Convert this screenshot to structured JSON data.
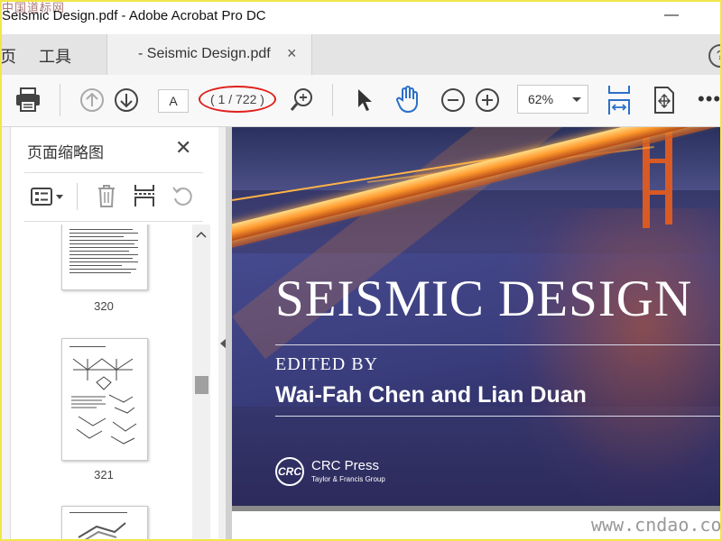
{
  "watermark": {
    "top": "中国道标网",
    "bottom": "www.cndao.com"
  },
  "window": {
    "title": "Seismic Design.pdf - Adobe Acrobat Pro DC",
    "minimize": "—"
  },
  "tabs": {
    "home": "页",
    "tools": "工具",
    "document": "- Seismic Design.pdf",
    "close": "×",
    "help": "?"
  },
  "toolbar": {
    "page_input": "A",
    "page_count": "( 1 / 722 )",
    "zoom": "62%",
    "more": "•••",
    "icons": [
      "print-icon",
      "page-up-icon",
      "page-down-icon",
      "find-icon",
      "select-cursor-icon",
      "hand-icon",
      "zoom-out-icon",
      "zoom-in-icon",
      "fit-width-icon",
      "scroll-mode-icon"
    ]
  },
  "sidebar": {
    "title": "页面缩略图",
    "close": "✕",
    "icons": [
      "options-icon",
      "trash-icon",
      "insert-icon",
      "rotate-icon"
    ],
    "thumbnails": [
      {
        "label": "320"
      },
      {
        "label": "321"
      },
      {
        "label": ""
      }
    ]
  },
  "cover": {
    "title": "SEISMIC DESIGN",
    "edited_by": "EDITED BY",
    "authors": "Wai-Fah Chen and Lian Duan",
    "logo": "CRC",
    "publisher": "CRC Press",
    "publisher_sub": "Taylor & Francis Group"
  },
  "colors": {
    "accent_red": "#e0201c",
    "acrobat_blue": "#2b70c9",
    "cover_navy": "#3a3f78"
  }
}
